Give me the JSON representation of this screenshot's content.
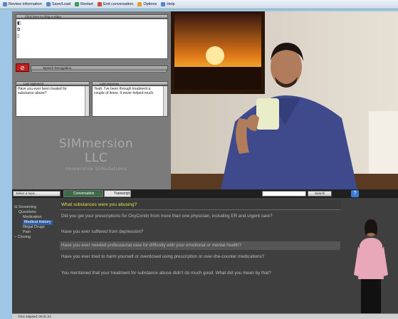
{
  "menu": {
    "items": [
      {
        "label": "Review information",
        "icon": "review-icon"
      },
      {
        "label": "Save/Load",
        "icon": "save-icon"
      },
      {
        "label": "Restart",
        "icon": "restart-icon"
      },
      {
        "label": "End conversation",
        "icon": "end-icon"
      },
      {
        "label": "Options",
        "icon": "options-icon"
      },
      {
        "label": "Help",
        "icon": "help-icon"
      }
    ]
  },
  "left_panel": {
    "drop_header": "Click here to drag a video",
    "speech_recognition_label": "Speech Recognition",
    "last_statement_label": "Last statement",
    "last_response_label": "Last response",
    "last_statement_text": "Have you ever been treated for substance abuse?",
    "last_response_text": "Yeah. I've been through treatment a couple of times. It never helped much.",
    "logo_line1": "SIMmersion LLC",
    "logo_line2": "Immersive Simulations"
  },
  "toolbar": {
    "select_label": "Select a topic...",
    "tab_active": "Conversation",
    "tab_inactive": "Transcript",
    "search_button": "Search",
    "help_label": "?"
  },
  "nav": {
    "items": [
      {
        "label": "Screening",
        "level": 0
      },
      {
        "label": "Questions",
        "level": 0
      },
      {
        "label": "Medication",
        "level": 1
      },
      {
        "label": "Medical History",
        "level": 1,
        "selected": true
      },
      {
        "label": "Illegal Drugs",
        "level": 1
      },
      {
        "label": "Pain",
        "level": 1
      },
      {
        "label": "Closing",
        "level": 0
      }
    ]
  },
  "questions": {
    "header": "What substances were you abusing?",
    "items": [
      {
        "text": "Did you get your prescriptions for OxyContin from more than one physician, including ER and urgent care?"
      },
      {
        "text": "Have you ever suffered from depression?"
      },
      {
        "text": "Have you ever needed professional care for difficulty with your emotional or mental health?",
        "highlighted": true
      },
      {
        "text": "Have you ever tried to harm yourself or overdosed using prescription or over-the-counter medications?"
      },
      {
        "text": "You mentioned that your treatment for substance abuse didn't do much good.  What did you mean by that?"
      }
    ]
  },
  "status": {
    "time_elapsed": "Time elapsed: 00:01:24"
  }
}
